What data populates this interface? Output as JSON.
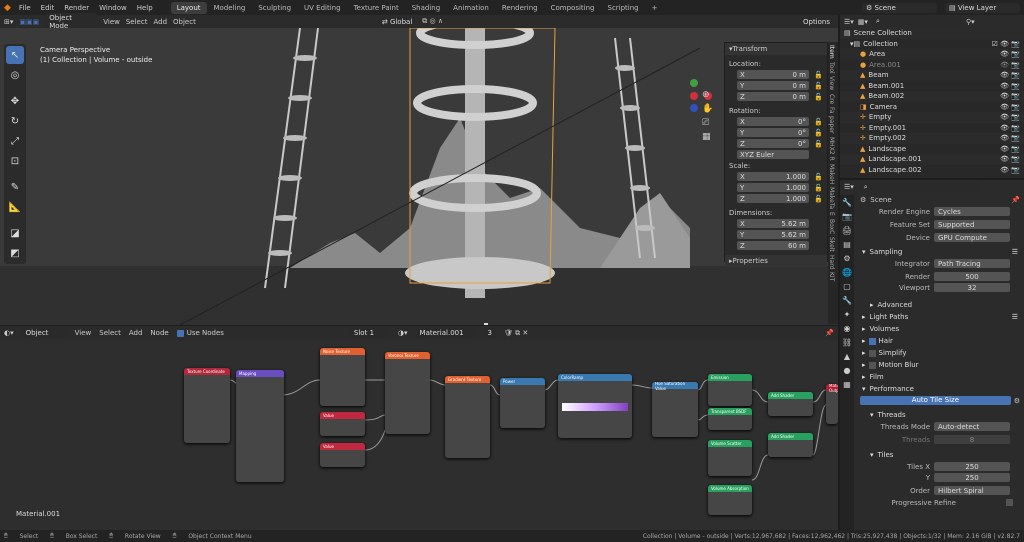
{
  "topbar": {
    "menus": [
      "File",
      "Edit",
      "Render",
      "Window",
      "Help"
    ],
    "workspaces": [
      "Layout",
      "Modeling",
      "Sculpting",
      "UV Editing",
      "Texture Paint",
      "Shading",
      "Animation",
      "Rendering",
      "Compositing",
      "Scripting",
      "+"
    ],
    "active_workspace": "Layout",
    "scene": "Scene",
    "view_layer": "View Layer"
  },
  "viewport": {
    "mode": "Object Mode",
    "menus": [
      "View",
      "Select",
      "Add",
      "Object"
    ],
    "transform": "Global",
    "options": "Options",
    "info_line1": "Camera Perspective",
    "info_line2": "(1) Collection | Volume - outside",
    "npanel": {
      "transform_title": "Transform",
      "location_label": "Location:",
      "location": [
        {
          "axis": "X",
          "value": "0 m"
        },
        {
          "axis": "Y",
          "value": "0 m"
        },
        {
          "axis": "Z",
          "value": "0 m"
        }
      ],
      "rotation_label": "Rotation:",
      "rotation": [
        {
          "axis": "X",
          "value": "0°"
        },
        {
          "axis": "Y",
          "value": "0°"
        },
        {
          "axis": "Z",
          "value": "0°"
        }
      ],
      "euler": "XYZ Euler",
      "scale_label": "Scale:",
      "scale": [
        {
          "axis": "X",
          "value": "1.000"
        },
        {
          "axis": "Y",
          "value": "1.000"
        },
        {
          "axis": "Z",
          "value": "1.000"
        }
      ],
      "dimensions_label": "Dimensions:",
      "dimensions": [
        {
          "axis": "X",
          "value": "5.62 m"
        },
        {
          "axis": "Y",
          "value": "5.62 m"
        },
        {
          "axis": "Z",
          "value": "60 m"
        }
      ],
      "properties_title": "Properties"
    },
    "side_tabs": [
      "Item",
      "Tool",
      "View",
      "Cre",
      "Fa",
      "paper",
      "MHX2 R",
      "MakeH",
      "MakeTa",
      "E",
      "BoxC",
      "Skelt",
      "Hard",
      "KIT"
    ]
  },
  "node_editor": {
    "type": "Object",
    "menus": [
      "View",
      "Select",
      "Add",
      "Node"
    ],
    "use_nodes": "Use Nodes",
    "slot": "Slot 1",
    "material": "Material.001",
    "users": "3",
    "footer_label": "Material.001",
    "nodes": [
      "Texture Coordinate",
      "Mapping",
      "Noise Texture",
      "Voronoi Texture",
      "Value",
      "Value",
      "Gradient Texture",
      "Power",
      "ColorRamp",
      "Hue Saturation Value",
      "Emission",
      "Transparent BSDF",
      "Add Shader",
      "Add Shader",
      "Volume Scatter",
      "Volume Absorption",
      "Material Output"
    ]
  },
  "outliner": {
    "root": "Scene Collection",
    "items": [
      {
        "name": "Collection",
        "level": 0
      },
      {
        "name": "Area",
        "level": 1
      },
      {
        "name": "Area.001",
        "level": 1
      },
      {
        "name": "Beam",
        "level": 1
      },
      {
        "name": "Beam.001",
        "level": 1
      },
      {
        "name": "Beam.002",
        "level": 1
      },
      {
        "name": "Camera",
        "level": 1
      },
      {
        "name": "Empty",
        "level": 1
      },
      {
        "name": "Empty.001",
        "level": 1
      },
      {
        "name": "Empty.002",
        "level": 1
      },
      {
        "name": "Landscape",
        "level": 1
      },
      {
        "name": "Landscape.001",
        "level": 1
      },
      {
        "name": "Landscape.002",
        "level": 1
      }
    ]
  },
  "properties": {
    "context": "Scene",
    "render_engine_label": "Render Engine",
    "render_engine": "Cycles",
    "feature_set_label": "Feature Set",
    "feature_set": "Supported",
    "device_label": "Device",
    "device": "GPU Compute",
    "sampling": "Sampling",
    "integrator_label": "Integrator",
    "integrator": "Path Tracing",
    "render_label": "Render",
    "render_samples": "500",
    "viewport_label": "Viewport",
    "viewport_samples": "32",
    "advanced": "Advanced",
    "light_paths": "Light Paths",
    "volumes": "Volumes",
    "hair": "Hair",
    "simplify": "Simplify",
    "motion_blur": "Motion Blur",
    "film": "Film",
    "performance": "Performance",
    "auto_tile": "Auto Tile Size",
    "threads": "Threads",
    "threads_mode_label": "Threads Mode",
    "threads_mode": "Auto-detect",
    "threads_count_label": "Threads",
    "threads_count": "8",
    "tiles": "Tiles",
    "tiles_x_label": "Tiles X",
    "tiles_x": "250",
    "tiles_y_label": "Y",
    "tiles_y": "250",
    "order_label": "Order",
    "order": "Hilbert Spiral",
    "progressive_refine": "Progressive Refine"
  },
  "statusbar": {
    "select": "Select",
    "box_select": "Box Select",
    "rotate_view": "Rotate View",
    "context_menu": "Object Context Menu",
    "stats": "Collection | Volume - outside | Verts:12,967,682 | Faces:12,962,462 | Tris:25,927,438 | Objects:1/32 | Mem: 2.16 GiB | v2.82.7"
  },
  "colors": {
    "accent": "#4772b3",
    "selection_orange": "#e8a040",
    "node_texture": "#e06030",
    "node_vector": "#6a4ec0",
    "node_converter": "#3a78b0",
    "node_shader": "#28a060",
    "node_value": "#c02840",
    "node_output": "#b02030"
  }
}
